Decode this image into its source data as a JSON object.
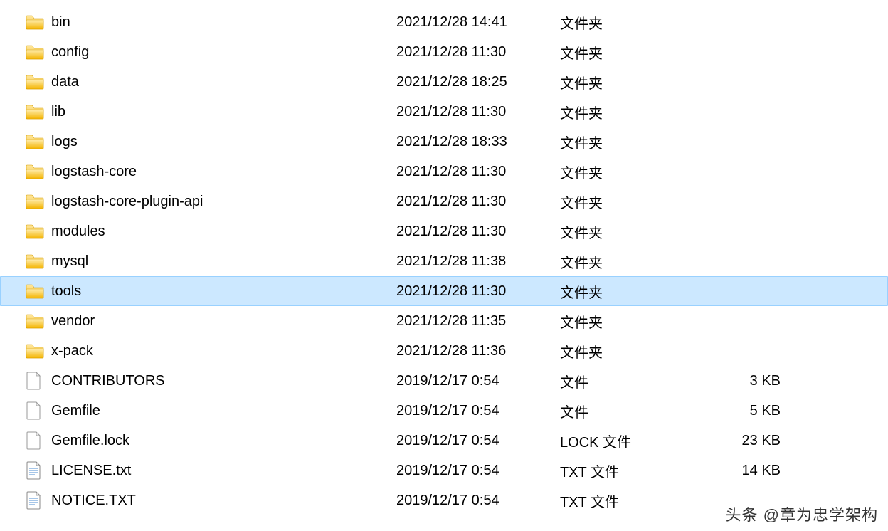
{
  "selected_index": 9,
  "watermark": "头条 @章为忠学架构",
  "items": [
    {
      "name": "bin",
      "date": "2021/12/28 14:41",
      "type": "文件夹",
      "size": "",
      "kind": "folder"
    },
    {
      "name": "config",
      "date": "2021/12/28 11:30",
      "type": "文件夹",
      "size": "",
      "kind": "folder"
    },
    {
      "name": "data",
      "date": "2021/12/28 18:25",
      "type": "文件夹",
      "size": "",
      "kind": "folder"
    },
    {
      "name": "lib",
      "date": "2021/12/28 11:30",
      "type": "文件夹",
      "size": "",
      "kind": "folder"
    },
    {
      "name": "logs",
      "date": "2021/12/28 18:33",
      "type": "文件夹",
      "size": "",
      "kind": "folder"
    },
    {
      "name": "logstash-core",
      "date": "2021/12/28 11:30",
      "type": "文件夹",
      "size": "",
      "kind": "folder"
    },
    {
      "name": "logstash-core-plugin-api",
      "date": "2021/12/28 11:30",
      "type": "文件夹",
      "size": "",
      "kind": "folder"
    },
    {
      "name": "modules",
      "date": "2021/12/28 11:30",
      "type": "文件夹",
      "size": "",
      "kind": "folder"
    },
    {
      "name": "mysql",
      "date": "2021/12/28 11:38",
      "type": "文件夹",
      "size": "",
      "kind": "folder"
    },
    {
      "name": "tools",
      "date": "2021/12/28 11:30",
      "type": "文件夹",
      "size": "",
      "kind": "folder"
    },
    {
      "name": "vendor",
      "date": "2021/12/28 11:35",
      "type": "文件夹",
      "size": "",
      "kind": "folder"
    },
    {
      "name": "x-pack",
      "date": "2021/12/28 11:36",
      "type": "文件夹",
      "size": "",
      "kind": "folder"
    },
    {
      "name": "CONTRIBUTORS",
      "date": "2019/12/17 0:54",
      "type": "文件",
      "size": "3 KB",
      "kind": "file"
    },
    {
      "name": "Gemfile",
      "date": "2019/12/17 0:54",
      "type": "文件",
      "size": "5 KB",
      "kind": "file"
    },
    {
      "name": "Gemfile.lock",
      "date": "2019/12/17 0:54",
      "type": "LOCK 文件",
      "size": "23 KB",
      "kind": "file"
    },
    {
      "name": "LICENSE.txt",
      "date": "2019/12/17 0:54",
      "type": "TXT 文件",
      "size": "14 KB",
      "kind": "txt"
    },
    {
      "name": "NOTICE.TXT",
      "date": "2019/12/17 0:54",
      "type": "TXT 文件",
      "size": "",
      "kind": "txt"
    }
  ]
}
